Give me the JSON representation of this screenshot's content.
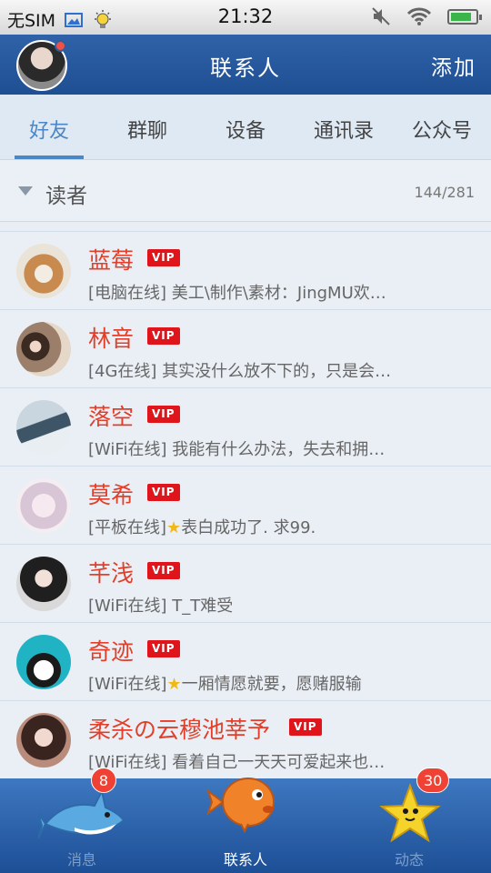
{
  "status_bar": {
    "carrier": "无SIM",
    "time": "21:32"
  },
  "header": {
    "title": "联系人",
    "add_label": "添加"
  },
  "tabs": [
    {
      "label": "好友",
      "active": true
    },
    {
      "label": "群聊",
      "active": false
    },
    {
      "label": "设备",
      "active": false
    },
    {
      "label": "通讯录",
      "active": false
    },
    {
      "label": "公众号",
      "active": false
    }
  ],
  "group": {
    "name": "读者",
    "count": "144/281"
  },
  "contacts": [
    {
      "name": "蓝莓",
      "vip": "VIP",
      "status": "[电脑在线] 美工\\制作\\素材：JingMU欢…"
    },
    {
      "name": "林音",
      "vip": "VIP",
      "status": "[4G在线] 其实没什么放不下的，只是会…"
    },
    {
      "name": "落空",
      "vip": "VIP",
      "status": "[WiFi在线] 我能有什么办法，失去和拥…"
    },
    {
      "name": "莫希",
      "vip": "VIP",
      "status_prefix": "[平板在线]",
      "status_star": "★",
      "status_suffix": "表白成功了. 求99."
    },
    {
      "name": "芊浅",
      "vip": "VIP",
      "status": "[WiFi在线] T_T难受"
    },
    {
      "name": "奇迹",
      "vip": "VIP",
      "status_prefix": "[WiFi在线]",
      "status_star": "★",
      "status_suffix": "一厢情愿就要，愿赌服输"
    },
    {
      "name": "柔杀の云穆池莘予",
      "vip": "VIP",
      "status": "[WiFi在线] 看着自己一天天可爱起来也…"
    }
  ],
  "bottom_bar": {
    "messages": {
      "label": "消息",
      "badge": "8"
    },
    "contacts": {
      "label": "联系人"
    },
    "moments": {
      "label": "动态",
      "badge": "30"
    }
  },
  "colors": {
    "header_blue": "#2f62a8",
    "accent_blue": "#4b86c6",
    "name_red": "#e23f2a",
    "vip_red": "#e0151b",
    "badge_red": "#ef4234"
  }
}
